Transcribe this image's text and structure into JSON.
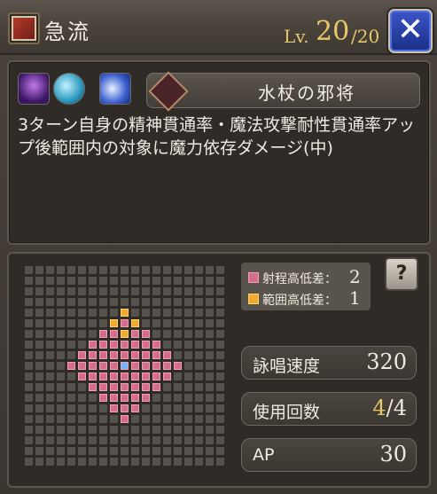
{
  "header": {
    "title": "急流",
    "level_label": "Lv.",
    "level_current": "20",
    "level_max": "/20",
    "close_label": "✕"
  },
  "description": {
    "icons": [
      "dark-magic-icon",
      "water-orb-icon",
      "crescent-moon-icon"
    ],
    "weapon_name": "水杖の邪将",
    "text": "3ターン自身の精神貫通率・魔法攻撃耐性貫通率アップ後範囲内の対象に魔力依存ダメージ(中)"
  },
  "range": {
    "legend": [
      {
        "label": "射程高低差：",
        "value": "2",
        "color": "#d76d8c"
      },
      {
        "label": "範囲高低差：",
        "value": "1",
        "color": "#f2a932"
      }
    ],
    "help_label": "?"
  },
  "stats": {
    "cast_speed_label": "詠唱速度",
    "cast_speed_value": "320",
    "uses_label": "使用回数",
    "uses_current": "4",
    "uses_max": "/4",
    "ap_label": "AP",
    "ap_value": "30"
  },
  "colors": {
    "accent_gold": "#e7c86a",
    "range_pink": "#d76d8c",
    "area_orange": "#f2a932",
    "center_blue": "#6fb6ff"
  }
}
